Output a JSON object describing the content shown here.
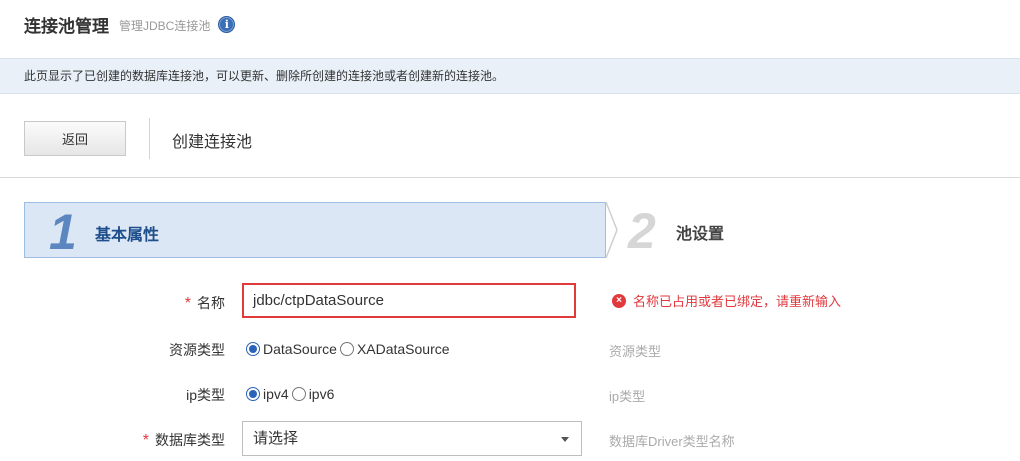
{
  "header": {
    "title": "连接池管理",
    "subtitle": "管理JDBC连接池",
    "info_icon": "i"
  },
  "description": "此页显示了已创建的数据库连接池，可以更新、删除所创建的连接池或者创建新的连接池。",
  "toolbar": {
    "back_label": "返回",
    "section_title": "创建连接池"
  },
  "wizard": {
    "steps": [
      {
        "number": "1",
        "label": "基本属性",
        "active": true
      },
      {
        "number": "2",
        "label": "池设置",
        "active": false
      }
    ]
  },
  "form": {
    "required_mark": "*",
    "name": {
      "label": "名称",
      "value": "jdbc/ctpDataSource",
      "error": "名称已占用或者已绑定，请重新输入",
      "error_icon": "×"
    },
    "resource_type": {
      "label": "资源类型",
      "options": [
        "DataSource",
        "XADataSource"
      ],
      "selected": "DataSource",
      "hint": "资源类型"
    },
    "ip_type": {
      "label": "ip类型",
      "options": [
        "ipv4",
        "ipv6"
      ],
      "selected": "ipv4",
      "hint": "ip类型"
    },
    "db_type": {
      "label": "数据库类型",
      "value": "请选择",
      "hint": "数据库Driver类型名称"
    }
  },
  "colors": {
    "accent": "#2a63b8",
    "error": "#e0393e",
    "step_active_bg": "#dbe7f5",
    "desc_bg": "#e9f0f8"
  }
}
